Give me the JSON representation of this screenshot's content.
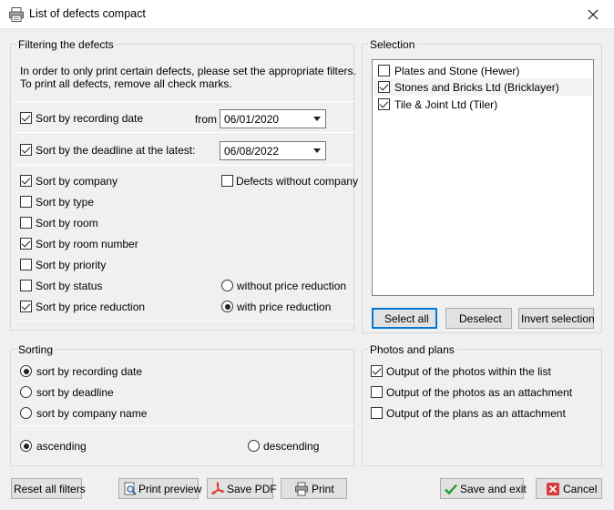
{
  "window": {
    "title": "List of defects compact"
  },
  "filter": {
    "group_title": "Filtering the defects",
    "info_line1": "In order to only print certain defects, please set the appropriate filters.",
    "info_line2": "To print all defects, remove all check marks.",
    "recording_date": {
      "label": "Sort by recording date",
      "checked": true,
      "from_label": "from",
      "value": "06/01/2020"
    },
    "deadline": {
      "label": "Sort by the deadline at the latest:",
      "checked": true,
      "value": "06/08/2022"
    },
    "options": [
      {
        "label": "Sort by company",
        "checked": true
      },
      {
        "label": "Sort by type",
        "checked": false
      },
      {
        "label": "Sort by room",
        "checked": false
      },
      {
        "label": "Sort by room number",
        "checked": true
      },
      {
        "label": "Sort by priority",
        "checked": false
      },
      {
        "label": "Sort by status",
        "checked": false
      },
      {
        "label": "Sort by price reduction",
        "checked": true
      }
    ],
    "without_company": {
      "label": "Defects without company",
      "checked": false
    },
    "price_reduction": [
      {
        "label": "without price reduction",
        "selected": false
      },
      {
        "label": "with price reduction",
        "selected": true
      }
    ]
  },
  "selection": {
    "group_title": "Selection",
    "items": [
      {
        "label": "Plates and Stone (Hewer)",
        "checked": false
      },
      {
        "label": "Stones and Bricks Ltd (Bricklayer)",
        "checked": true
      },
      {
        "label": "Tile & Joint Ltd (Tiler)",
        "checked": true
      }
    ],
    "select_all": "Select all",
    "deselect": "Deselect",
    "invert": "Invert selection"
  },
  "sorting": {
    "group_title": "Sorting",
    "options": [
      {
        "label": "sort by recording date",
        "selected": true
      },
      {
        "label": "sort by deadline",
        "selected": false
      },
      {
        "label": "sort by company name",
        "selected": false
      }
    ],
    "ascending": {
      "label": "ascending",
      "selected": true
    },
    "descending": {
      "label": "descending",
      "selected": false
    }
  },
  "photos": {
    "group_title": "Photos and plans",
    "options": [
      {
        "label": "Output of the photos within the list",
        "checked": true
      },
      {
        "label": "Output of the photos as an attachment",
        "checked": false
      },
      {
        "label": "Output of the plans as an attachment",
        "checked": false
      }
    ]
  },
  "buttons": {
    "reset": "Reset all filters",
    "preview": "Print preview",
    "save_pdf": "Save PDF",
    "print": "Print",
    "save_exit": "Save and exit",
    "cancel": "Cancel"
  },
  "colors": {
    "accent": "#0078d7",
    "pdf_red": "#d9342b",
    "ok_green": "#1f9e3a",
    "cancel_red": "#d83b3b"
  }
}
